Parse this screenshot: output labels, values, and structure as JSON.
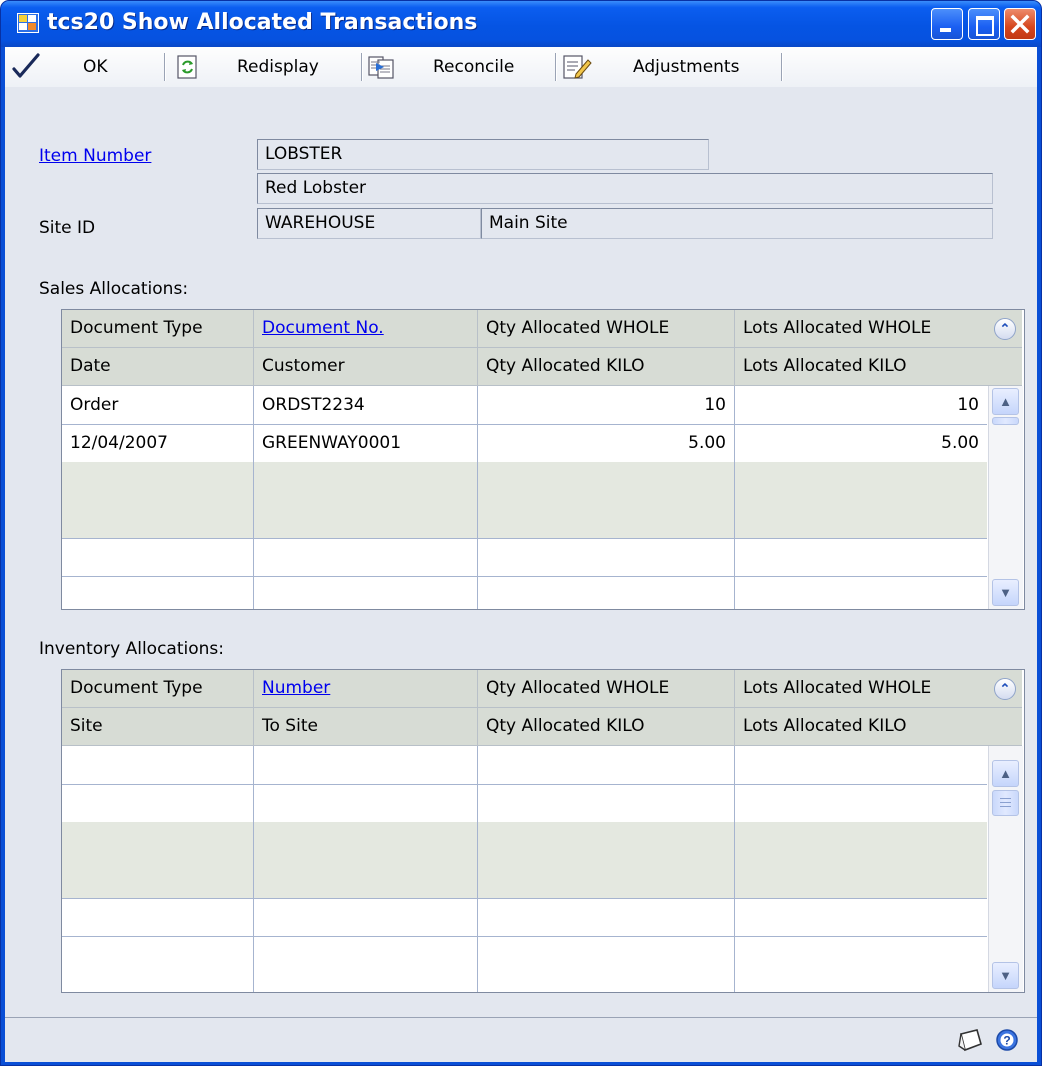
{
  "window": {
    "title": "tcs20 Show Allocated Transactions",
    "colors": {
      "title_bar": "#0554e3",
      "close_button": "#d5461e",
      "client_bg": "#e3e7ef",
      "link": "#0000ee"
    }
  },
  "toolbar": {
    "ok_label": "OK",
    "redisplay_label": "Redisplay",
    "reconcile_label": "Reconcile",
    "adjustments_label": "Adjustments"
  },
  "header": {
    "item_number_label": "Item Number",
    "item_number_value": "LOBSTER",
    "item_description": "Red Lobster",
    "site_id_label": "Site ID",
    "site_id_value": "WAREHOUSE",
    "site_name": "Main Site"
  },
  "sales": {
    "section_label": "Sales Allocations:",
    "columns_row1": [
      "Document Type",
      "Document No.",
      "Qty Allocated WHOLE",
      "Lots Allocated WHOLE"
    ],
    "columns_row2": [
      "Date",
      "Customer",
      "Qty Allocated KILO",
      "Lots Allocated KILO"
    ],
    "rows": [
      [
        "Order",
        "ORDST2234",
        "10",
        "10"
      ],
      [
        "12/04/2007",
        "GREENWAY0001",
        "5.00",
        "5.00"
      ],
      [
        "",
        "",
        "",
        ""
      ],
      [
        "",
        "",
        "",
        ""
      ],
      [
        "",
        "",
        "",
        ""
      ],
      [
        "",
        "",
        "",
        ""
      ]
    ]
  },
  "inventory": {
    "section_label": "Inventory Allocations:",
    "columns_row1": [
      "Document Type",
      "Number",
      "Qty Allocated WHOLE",
      "Lots Allocated WHOLE"
    ],
    "columns_row2": [
      "Site",
      "To Site",
      "Qty Allocated KILO",
      "Lots Allocated KILO"
    ],
    "rows": [
      [
        "",
        "",
        "",
        ""
      ],
      [
        "",
        "",
        "",
        ""
      ],
      [
        "",
        "",
        "",
        ""
      ],
      [
        "",
        "",
        "",
        ""
      ],
      [
        "",
        "",
        "",
        ""
      ],
      [
        "",
        "",
        "",
        ""
      ]
    ]
  },
  "footer": {
    "icons": [
      "note-icon",
      "help-icon"
    ]
  }
}
